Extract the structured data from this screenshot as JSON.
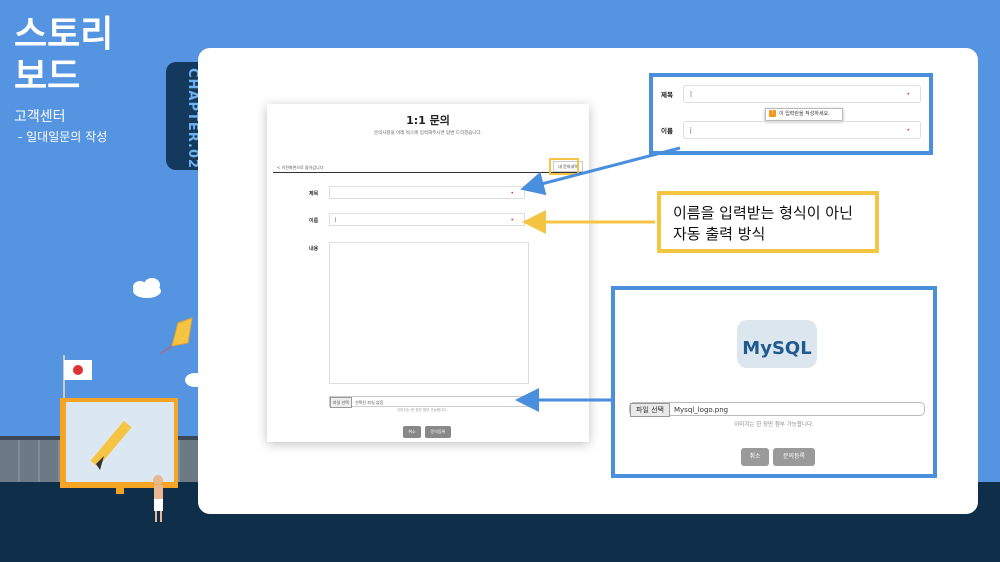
{
  "sidebar": {
    "title_line1": "스토리",
    "title_line2": "보드",
    "section": "고객센터",
    "subsection": "- 일대일문의 작성",
    "chapter": "CHAPTER.02"
  },
  "form": {
    "title": "1:1 문의",
    "description": "문의사항을 아래 박스에 입력해주시면 답변 드리겠습니다.",
    "back_link": "< 이전화면으로 돌아갑니다",
    "my_inquiry_button": "내 문의내역",
    "subject_label": "제목",
    "subject_value": "",
    "name_label": "이름",
    "name_value": "j",
    "content_label": "내용",
    "file_button": "파일 선택",
    "file_status": "선택된 파일 없음",
    "file_hint": "이미지는 한 장만 첨부 가능합니다.",
    "cancel_button": "취소",
    "submit_button": "문의등록"
  },
  "zoom_top": {
    "subject_label": "제목",
    "subject_value": "|",
    "name_label": "이름",
    "name_value": "j",
    "tooltip": "이 입력란을 작성하세요."
  },
  "callout": {
    "line1": "이름을 입력받는 형식이 아닌",
    "line2": "자동 출력 방식"
  },
  "zoom_bottom": {
    "logo_text": "MySQL",
    "file_button": "파일 선택",
    "file_name": "Mysql_logo.png",
    "file_hint": "이미지는 한 장만 첨부 가능합니다.",
    "cancel_button": "취소",
    "submit_button": "문의등록"
  },
  "colors": {
    "background": "#5594e0",
    "accent_blue": "#4a8ede",
    "accent_yellow": "#f5c443",
    "chapter_tab": "#133a5c"
  }
}
